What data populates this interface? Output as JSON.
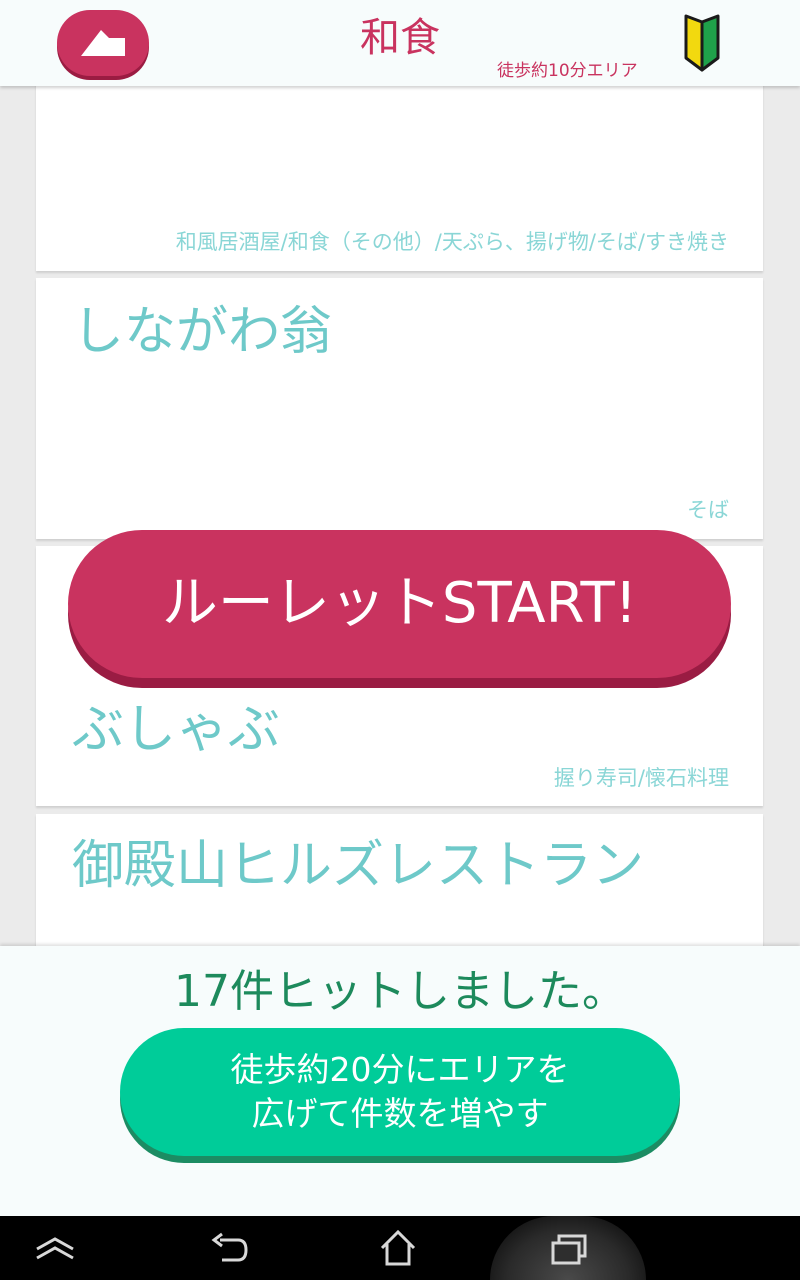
{
  "header": {
    "title": "和食",
    "area_label": "徒歩約10分エリア",
    "back_icon": "back-arrow-icon",
    "beginner_icon": "beginner-mark-icon"
  },
  "restaurants": [
    {
      "name": "",
      "genre": "和風居酒屋/和食（その他）/天ぷら、揚げ物/そば/すき焼き"
    },
    {
      "name": "しながわ翁",
      "genre": "そば"
    },
    {
      "name_line2": "ぶしゃぶ",
      "genre": "握り寿司/懐石料理"
    },
    {
      "name": "御殿山ヒルズレストラン",
      "genre": ""
    }
  ],
  "roulette": {
    "label": "ルーレットSTART!"
  },
  "bottom": {
    "hit_text": "17件ヒットしました。",
    "expand_line1": "徒歩約20分にエリアを",
    "expand_line2": "広げて件数を増やす"
  },
  "colors": {
    "accent": "#c9335f",
    "teal_text": "#6ec9c9",
    "green_button": "#00cc99",
    "hit_text": "#1d8a5c"
  },
  "navbar": {
    "icons": [
      "home-up-icon",
      "back-icon",
      "home-icon",
      "recent-apps-icon"
    ]
  }
}
